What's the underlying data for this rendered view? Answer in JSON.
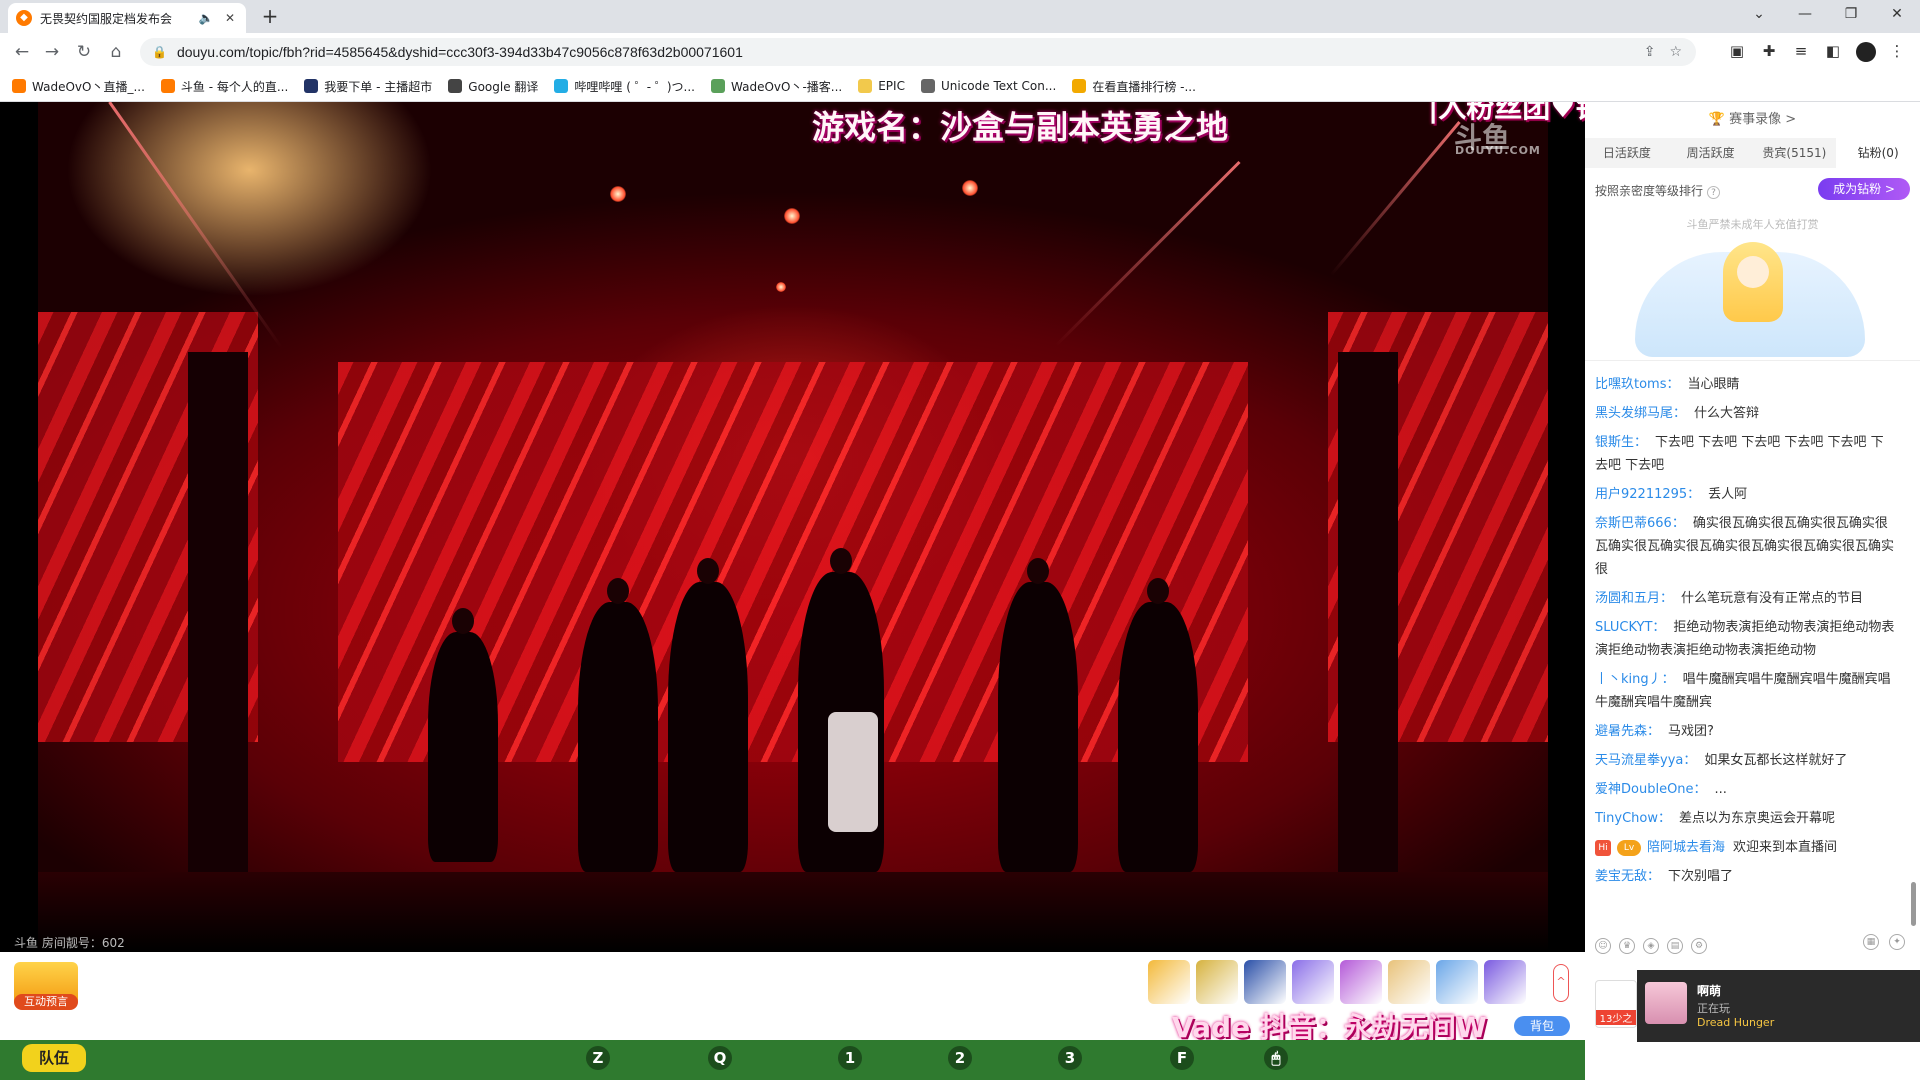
{
  "browser": {
    "tab_title": "无畏契约国服定档发布会",
    "tab_mute_icon": "speaker-icon",
    "tab_close": "✕",
    "new_tab": "+",
    "url": "douyu.com/topic/fbh?rid=4585645&dyshid=ccc30f3-394d33b47c9056c878f63d2b00071601",
    "bookmarks": [
      {
        "label": "WadeOvO丶直播_...",
        "color": "#ff7a00"
      },
      {
        "label": "斗鱼 - 每个人的直...",
        "color": "#ff7a00"
      },
      {
        "label": "我要下单 - 主播超市",
        "color": "#223366"
      },
      {
        "label": "Google 翻译",
        "color": "#444444"
      },
      {
        "label": "哔哩哔哩 ( ゜- ゜)つ...",
        "color": "#23ade5"
      },
      {
        "label": "WadeOvO丶-播客...",
        "color": "#5aa05a"
      },
      {
        "label": "EPIC",
        "color": "#f2c94c"
      },
      {
        "label": "Unicode Text Con...",
        "color": "#666666"
      },
      {
        "label": "在看直播排行榜 -...",
        "color": "#f2a900"
      }
    ]
  },
  "video": {
    "game_name_overlay": "游戏名：沙盒与副本英勇之地",
    "fans_overlay": "|入粉丝团♥钻粉加主播进",
    "watermark": "斗鱼",
    "watermark_sub": "DOUYU.COM",
    "room_id": "斗鱼 房间靓号：602"
  },
  "giftbar": {
    "interact_label": "互动预言",
    "vade_text": "Vade 抖音：永劫无间W",
    "backpack": "背包",
    "expand": "^",
    "gift_colors": [
      "#f3b93a",
      "#d6b23e",
      "#2a4fa8",
      "#8a6ee8",
      "#b45ad8",
      "#e8c27a",
      "#6aa6e8",
      "#7a5ae0"
    ]
  },
  "hud": {
    "team": "队伍",
    "keys": [
      "Z",
      "Q",
      "1",
      "2",
      "3",
      "F",
      "🖱"
    ]
  },
  "sidebar": {
    "match_record": "赛事录像 >",
    "rank_tabs": [
      "日活跃度",
      "周活跃度",
      "贵宾(5151)",
      "钻粉(0)"
    ],
    "rank_sort": "按照亲密度等级排行",
    "help": "?",
    "become_fan": "成为钻粉 >",
    "minor_notice": "斗鱼严禁未成年人充值打赏",
    "chat": [
      {
        "user": "比嘿玖toms：",
        "text": "当心眼睛"
      },
      {
        "user": "黑头发绑马尾：",
        "text": "什么大答辩"
      },
      {
        "user": "银斯生：",
        "text": "下去吧 下去吧 下去吧 下去吧 下去吧 下去吧 下去吧"
      },
      {
        "user": "用户92211295：",
        "text": "丢人阿"
      },
      {
        "user": "奈斯巴蒂666：",
        "text": "确实很瓦确实很瓦确实很瓦确实很瓦确实很瓦确实很瓦确实很瓦确实很瓦确实很瓦确实很"
      },
      {
        "user": "汤圆和五月：",
        "text": "什么笔玩意有没有正常点的节目"
      },
      {
        "user": "SLUCKYT：",
        "text": "拒绝动物表演拒绝动物表演拒绝动物表演拒绝动物表演拒绝动物表演拒绝动物"
      },
      {
        "user": "丨丶king丿：",
        "text": "唱牛魔酬宾唱牛魔酬宾唱牛魔酬宾唱牛魔酬宾唱牛魔酬宾"
      },
      {
        "user": "避暑先森：",
        "text": "马戏团?"
      },
      {
        "user": "天马流星拳yya：",
        "text": "如果女瓦都长这样就好了"
      },
      {
        "user": "爱神DoubleOne：",
        "text": "..."
      },
      {
        "user": "TinyChow：",
        "text": "差点以为东京奥运会开幕呢"
      },
      {
        "user": "陪阿城去看海",
        "text": "欢迎来到本直播间",
        "badges": [
          "Hi",
          "Lv"
        ]
      },
      {
        "user": "姜宝无敌：",
        "text": "下次别唱了"
      }
    ],
    "mini_badge_label": "13少之",
    "now_playing": {
      "name": "啊萌",
      "status": "正在玩",
      "game": "Dread Hunger"
    }
  }
}
